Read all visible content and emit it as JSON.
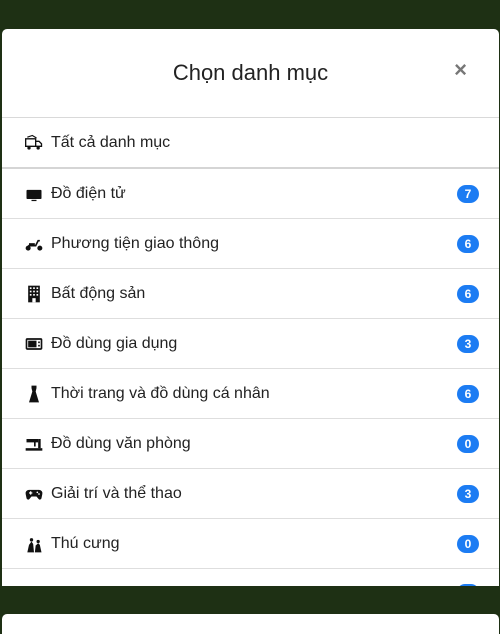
{
  "modal": {
    "title": "Chọn danh mục",
    "close_label": "×"
  },
  "categories": [
    {
      "label": "Tất cả danh mục",
      "icon": "truck-icon",
      "count": ""
    },
    {
      "label": "Đồ điện tử",
      "icon": "tv-icon",
      "count": "7"
    },
    {
      "label": "Phương tiện giao thông",
      "icon": "scooter-icon",
      "count": "6"
    },
    {
      "label": "Bất động sản",
      "icon": "building-icon",
      "count": "6"
    },
    {
      "label": "Đồ dùng gia dụng",
      "icon": "microwave-icon",
      "count": "3"
    },
    {
      "label": "Thời trang và đồ dùng cá nhân",
      "icon": "dress-icon",
      "count": "6"
    },
    {
      "label": "Đồ dùng văn phòng",
      "icon": "sewing-machine-icon",
      "count": "0"
    },
    {
      "label": "Giải trí và thể thao",
      "icon": "gamepad-icon",
      "count": "3"
    },
    {
      "label": "Thú cưng",
      "icon": "pets-icon",
      "count": "0"
    }
  ],
  "colors": {
    "backdrop": "#1e3014",
    "badge": "#1c7cf3"
  }
}
